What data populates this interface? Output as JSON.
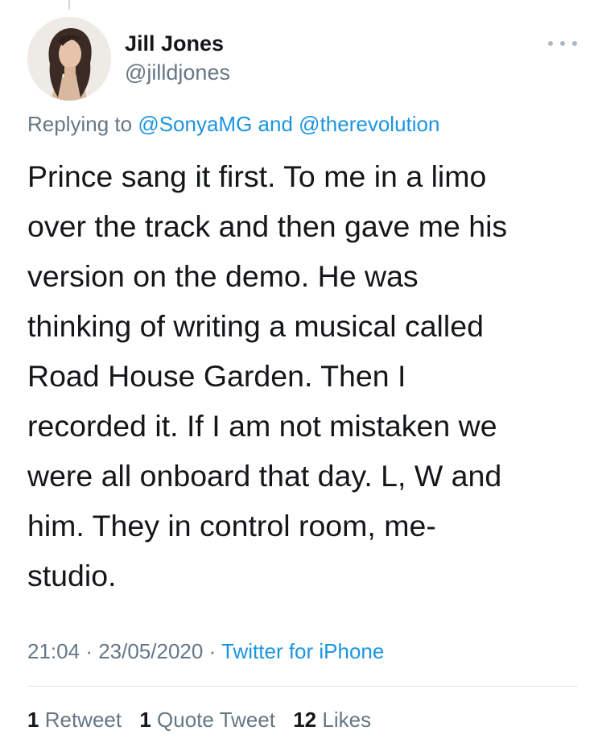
{
  "tweet": {
    "author": {
      "display_name": "Jill Jones",
      "handle": "@jilldjones",
      "avatar_icon": "profile-photo"
    },
    "reply": {
      "prefix": "Replying to",
      "mention_1": "@SonyaMG",
      "connector": "and",
      "mention_2": "@therevolution"
    },
    "text_lines": [
      "Prince sang it first. To me in a limo",
      "over the track and then gave me his",
      "version on the demo. He was",
      "thinking of writing a musical called",
      "Road House Garden. Then I",
      "recorded it. If I am not mistaken we",
      "were all onboard that day. L, W and",
      "him. They in control room, me-",
      "studio."
    ],
    "time": "21:04",
    "separator": "·",
    "date": "23/05/2020",
    "source": "Twitter for iPhone",
    "stats": {
      "retweets_count": "1",
      "retweets_label": "Retweet",
      "quotes_count": "1",
      "quotes_label": "Quote Tweet",
      "likes_count": "12",
      "likes_label": "Likes"
    }
  },
  "colors": {
    "text": "#14171a",
    "secondary": "#657786",
    "link": "#1b95e0",
    "divider": "#dfe5e9"
  }
}
